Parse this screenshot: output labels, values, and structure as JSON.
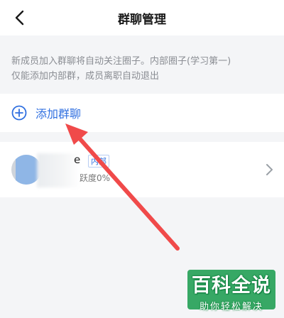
{
  "header": {
    "title": "群聊管理",
    "back_icon": "chevron-left-icon"
  },
  "notice": {
    "line1": "新成员加入群聊将自动关注圈子。内部圈子(学习第一)",
    "line2": "仅能添加内部群，成员离职自动退出"
  },
  "add_group": {
    "label": "添加群聊",
    "icon": "plus-circle-icon",
    "color": "#2f6fe0"
  },
  "group_item": {
    "name_suffix": "e",
    "tag": "内部",
    "activity": "跃度0%",
    "chevron_icon": "chevron-right-icon"
  },
  "watermark": {
    "main": "百科全说",
    "sub": "助你轻松解决"
  },
  "colors": {
    "accent": "#2f6fe0",
    "arrow": "#f04a4a",
    "watermark_green": "#22a054"
  }
}
